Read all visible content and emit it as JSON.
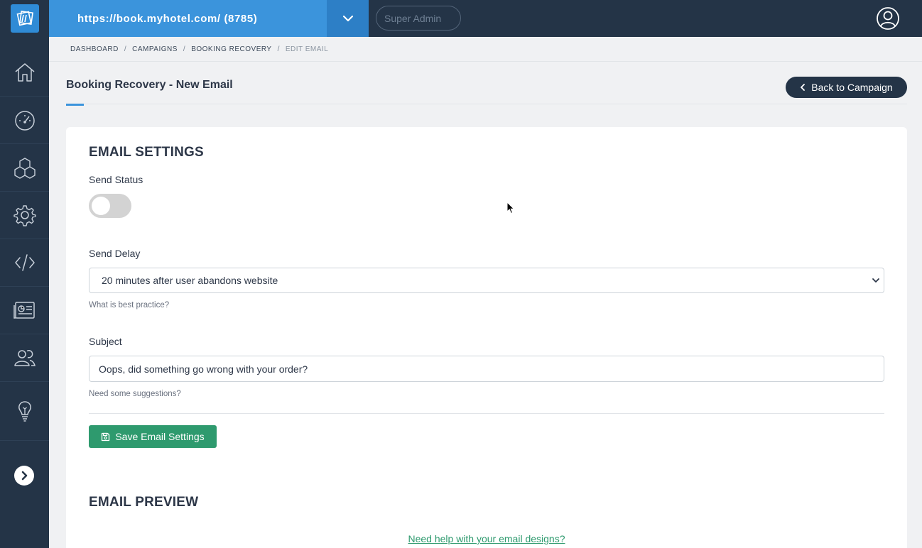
{
  "header": {
    "site_url": "https://book.myhotel.com/ (8785)",
    "role": "Super Admin",
    "icons": {
      "logo": "brand-logo-icon",
      "dropdown": "chevron-down-icon",
      "user": "user-circle-icon"
    }
  },
  "sidebar": {
    "items": [
      {
        "icon": "home-icon"
      },
      {
        "icon": "dashboard-gauge-icon"
      },
      {
        "icon": "boxes-icon"
      },
      {
        "icon": "gear-icon"
      },
      {
        "icon": "code-icon"
      },
      {
        "icon": "newspaper-icon"
      },
      {
        "icon": "users-icon"
      },
      {
        "icon": "lightbulb-icon"
      }
    ],
    "expand_icon": "chevron-right-circle-icon"
  },
  "breadcrumb": {
    "items": [
      "DASHBOARD",
      "CAMPAIGNS",
      "BOOKING RECOVERY"
    ],
    "current": "EDIT EMAIL",
    "separator": "/"
  },
  "page": {
    "title": "Booking Recovery - New Email",
    "back_label": "Back to Campaign"
  },
  "settings": {
    "heading": "EMAIL SETTINGS",
    "send_status_label": "Send Status",
    "send_status_on": false,
    "send_delay_label": "Send Delay",
    "send_delay_value": "20 minutes after user abandons website",
    "send_delay_help": "What is best practice?",
    "subject_label": "Subject",
    "subject_value": "Oops, did something go wrong with your order?",
    "subject_help": "Need some suggestions?",
    "save_label": "Save Email Settings"
  },
  "preview": {
    "heading": "EMAIL PREVIEW",
    "help_link": "Need help with your email designs?"
  },
  "colors": {
    "nav_dark": "#243447",
    "url_blue": "#3b94dc",
    "accent_green": "#2e9a6e"
  }
}
